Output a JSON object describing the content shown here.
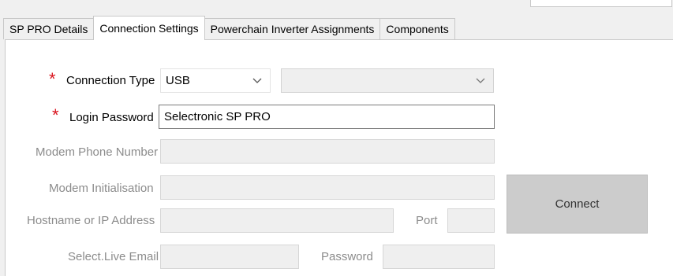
{
  "tabs": [
    {
      "label": "SP PRO Details"
    },
    {
      "label": "Connection Settings"
    },
    {
      "label": "Powerchain Inverter Assignments"
    },
    {
      "label": "Components"
    }
  ],
  "form": {
    "required_mark": "*",
    "connection_type": {
      "label": "Connection Type",
      "value": "USB",
      "secondary_value": ""
    },
    "login_password": {
      "label": "Login Password",
      "value": "Selectronic SP PRO"
    },
    "modem_phone_number": {
      "label": "Modem Phone Number",
      "value": ""
    },
    "modem_initialisation": {
      "label": "Modem Initialisation",
      "value": ""
    },
    "hostname": {
      "label": "Hostname or IP Address",
      "value": ""
    },
    "port": {
      "label": "Port",
      "value": ""
    },
    "select_live_email": {
      "label": "Select.Live Email",
      "value": ""
    },
    "password": {
      "label": "Password",
      "value": ""
    }
  },
  "connect_button": {
    "label": "Connect"
  },
  "colors": {
    "required": "#d9141e",
    "disabled_text": "#8c8c8c",
    "button_bg": "#cccccc"
  }
}
